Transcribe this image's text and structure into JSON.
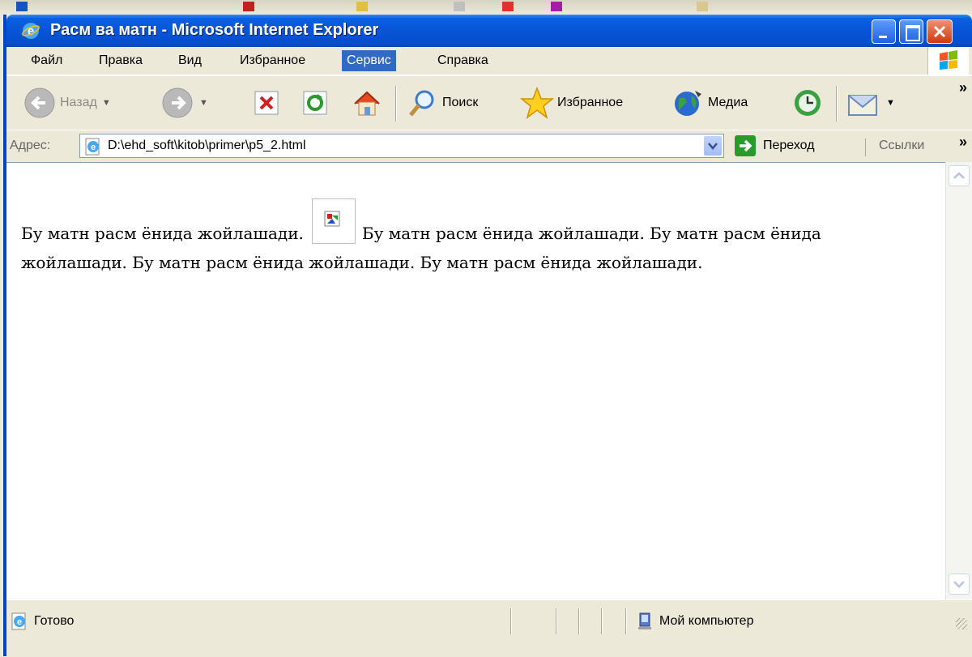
{
  "window": {
    "title": "Расм ва матн - Microsoft Internet Explorer"
  },
  "menu": {
    "items": [
      "Файл",
      "Правка",
      "Вид",
      "Избранное",
      "Сервис",
      "Справка"
    ],
    "active_index": 4
  },
  "toolbar": {
    "back_label": "Назад",
    "search_label": "Поиск",
    "favorites_label": "Избранное",
    "media_label": "Медиа",
    "overflow": "»"
  },
  "address": {
    "label": "Адрес:",
    "url": "D:\\ehd_soft\\kitob\\primer\\p5_2.html",
    "go_label": "Переход",
    "links_label": "Ссылки",
    "overflow": "»"
  },
  "page": {
    "text_before": "Бу матн расм ёнида жойлашади.",
    "text_after": "Бу матн расм ёнида жойлашади. Бу матн расм ёнида жойлашади. Бу матн расм ёнида жойлашади. Бу матн расм ёнида жойлашади."
  },
  "status": {
    "ready": "Готово",
    "zone": "Мой компьютер"
  },
  "colors": {
    "title_bar": "#0754d7",
    "menu_active": "#316ac5",
    "chrome": "#ece9d8"
  }
}
